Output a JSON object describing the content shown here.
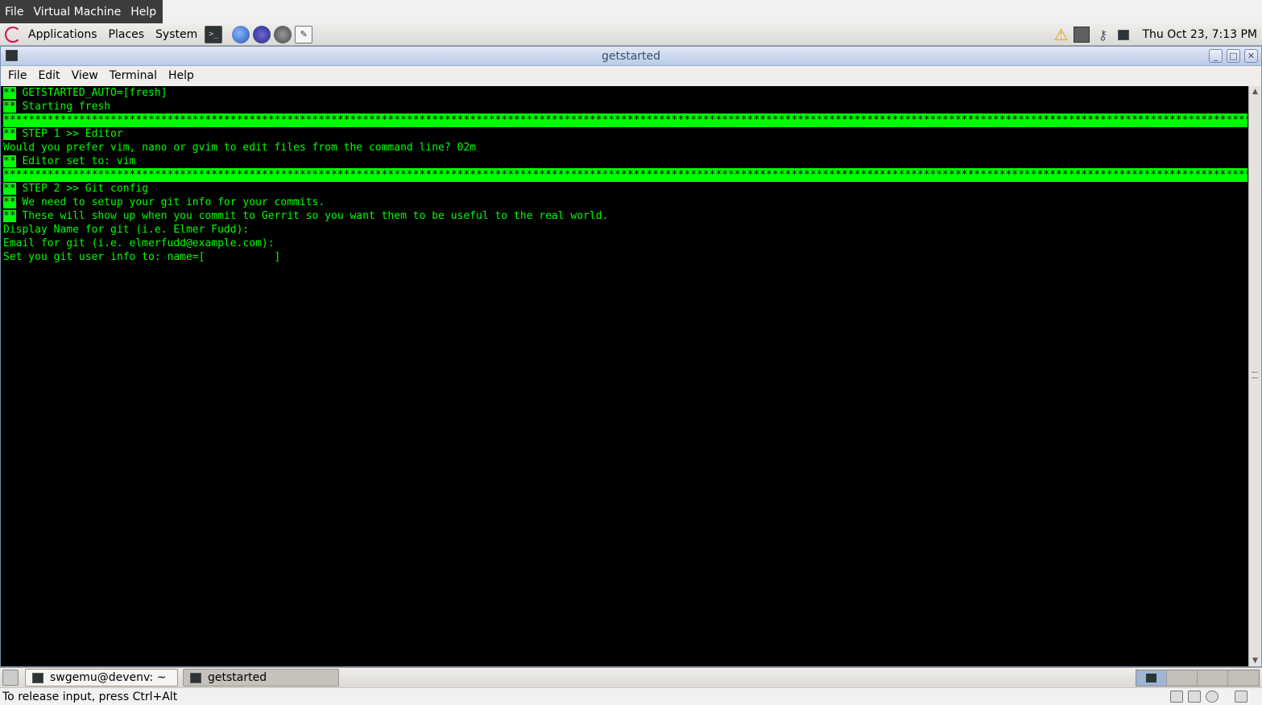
{
  "vm_menu": [
    "File",
    "Virtual Machine",
    "Help"
  ],
  "top_panel": {
    "menus": [
      "Applications",
      "Places",
      "System"
    ],
    "launchers": [
      "terminal-launcher",
      "web-browser-launcher",
      "eclipse-launcher",
      "database-launcher",
      "text-editor-launcher"
    ],
    "clock": "Thu Oct 23,  7:13 PM"
  },
  "window": {
    "title": "getstarted",
    "menu": [
      "File",
      "Edit",
      "View",
      "Terminal",
      "Help"
    ]
  },
  "terminal": {
    "lines": [
      {
        "prefix": "**",
        "text": " GETSTARTED_AUTO=[fresh]"
      },
      {
        "prefix": "**",
        "text": " Starting fresh"
      },
      {
        "full": "******************************************************************************************************************************************************************************************************"
      },
      {
        "prefix": "**",
        "text": " STEP 1 >> Editor"
      },
      {
        "text": "Would you prefer vim, nano or gvim to edit files from the command line? 02m"
      },
      {
        "prefix": "**",
        "text": " Editor set to: vim"
      },
      {
        "full": "******************************************************************************************************************************************************************************************************"
      },
      {
        "prefix": "**",
        "text": " STEP 2 >> Git config"
      },
      {
        "prefix": "**",
        "text": " We need to setup your git info for your commits."
      },
      {
        "prefix": "**",
        "text": " These will show up when you commit to Gerrit so you want them to be useful to the real world."
      },
      {
        "text": "Display Name for git (i.e. Elmer Fudd):"
      },
      {
        "text": "Email for git (i.e. elmerfudd@example.com):"
      },
      {
        "text": "Set you git user info to: name=[           ]"
      }
    ]
  },
  "taskbar": {
    "tasks": [
      "swgemu@devenv: ~",
      "getstarted"
    ]
  },
  "vm_status": "To release input, press Ctrl+Alt"
}
